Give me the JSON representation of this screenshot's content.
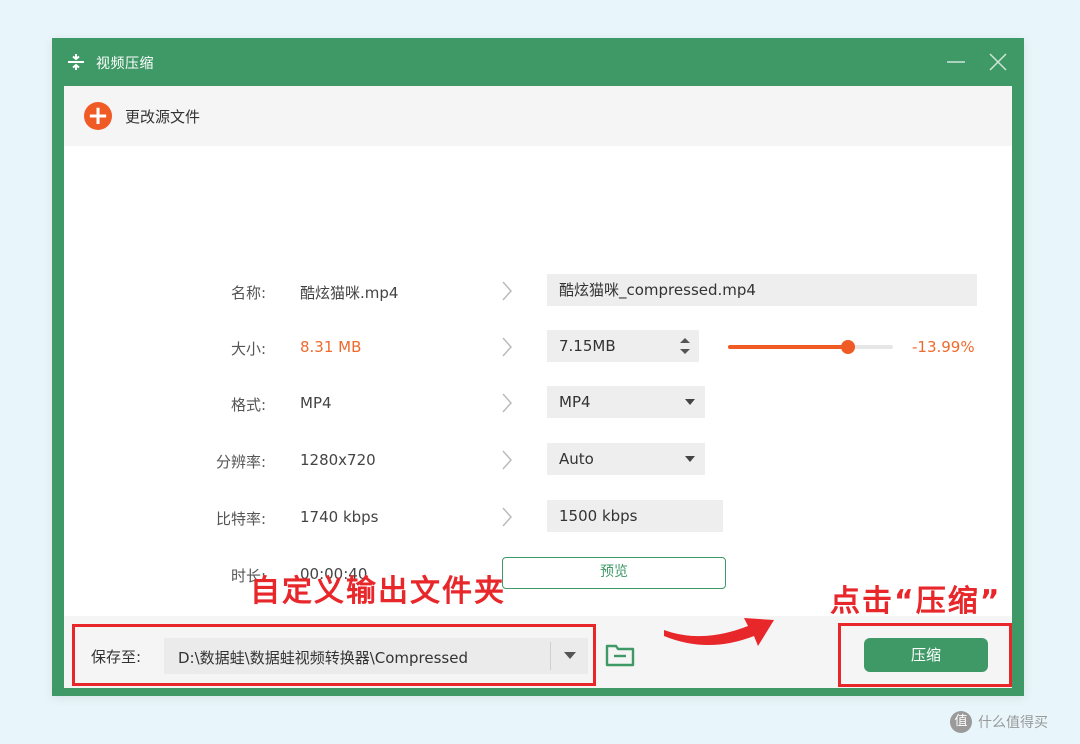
{
  "window": {
    "title": "视频压缩"
  },
  "toolbar": {
    "change_source_label": "更改源文件"
  },
  "rows": {
    "name": {
      "label": "名称:",
      "source": "酷炫猫咪.mp4",
      "target": "酷炫猫咪_compressed.mp4"
    },
    "size": {
      "label": "大小:",
      "source": "8.31 MB",
      "target": "7.15MB",
      "slider_fraction": 0.73,
      "percent": "-13.99%"
    },
    "format": {
      "label": "格式:",
      "source": "MP4",
      "target": "MP4"
    },
    "resolution": {
      "label": "分辨率:",
      "source": "1280x720",
      "target": "Auto"
    },
    "bitrate": {
      "label": "比特率:",
      "source": "1740 kbps",
      "target": "1500 kbps"
    },
    "duration": {
      "label": "时长:",
      "source": "00:00:40",
      "preview_label": "预览"
    }
  },
  "annotations": {
    "custom_folder": "自定义输出文件夹",
    "click_compress": "点击“压缩”"
  },
  "savebar": {
    "save_label": "保存至:",
    "path": "D:\\数据蛙\\数据蛙视频转换器\\Compressed",
    "compress_label": "压缩"
  },
  "watermark": {
    "icon_text": "值",
    "text": "什么值得买"
  },
  "colors": {
    "brand_green": "#3f9966",
    "accent_orange": "#f05a24",
    "annotation_red": "#e8272b"
  }
}
